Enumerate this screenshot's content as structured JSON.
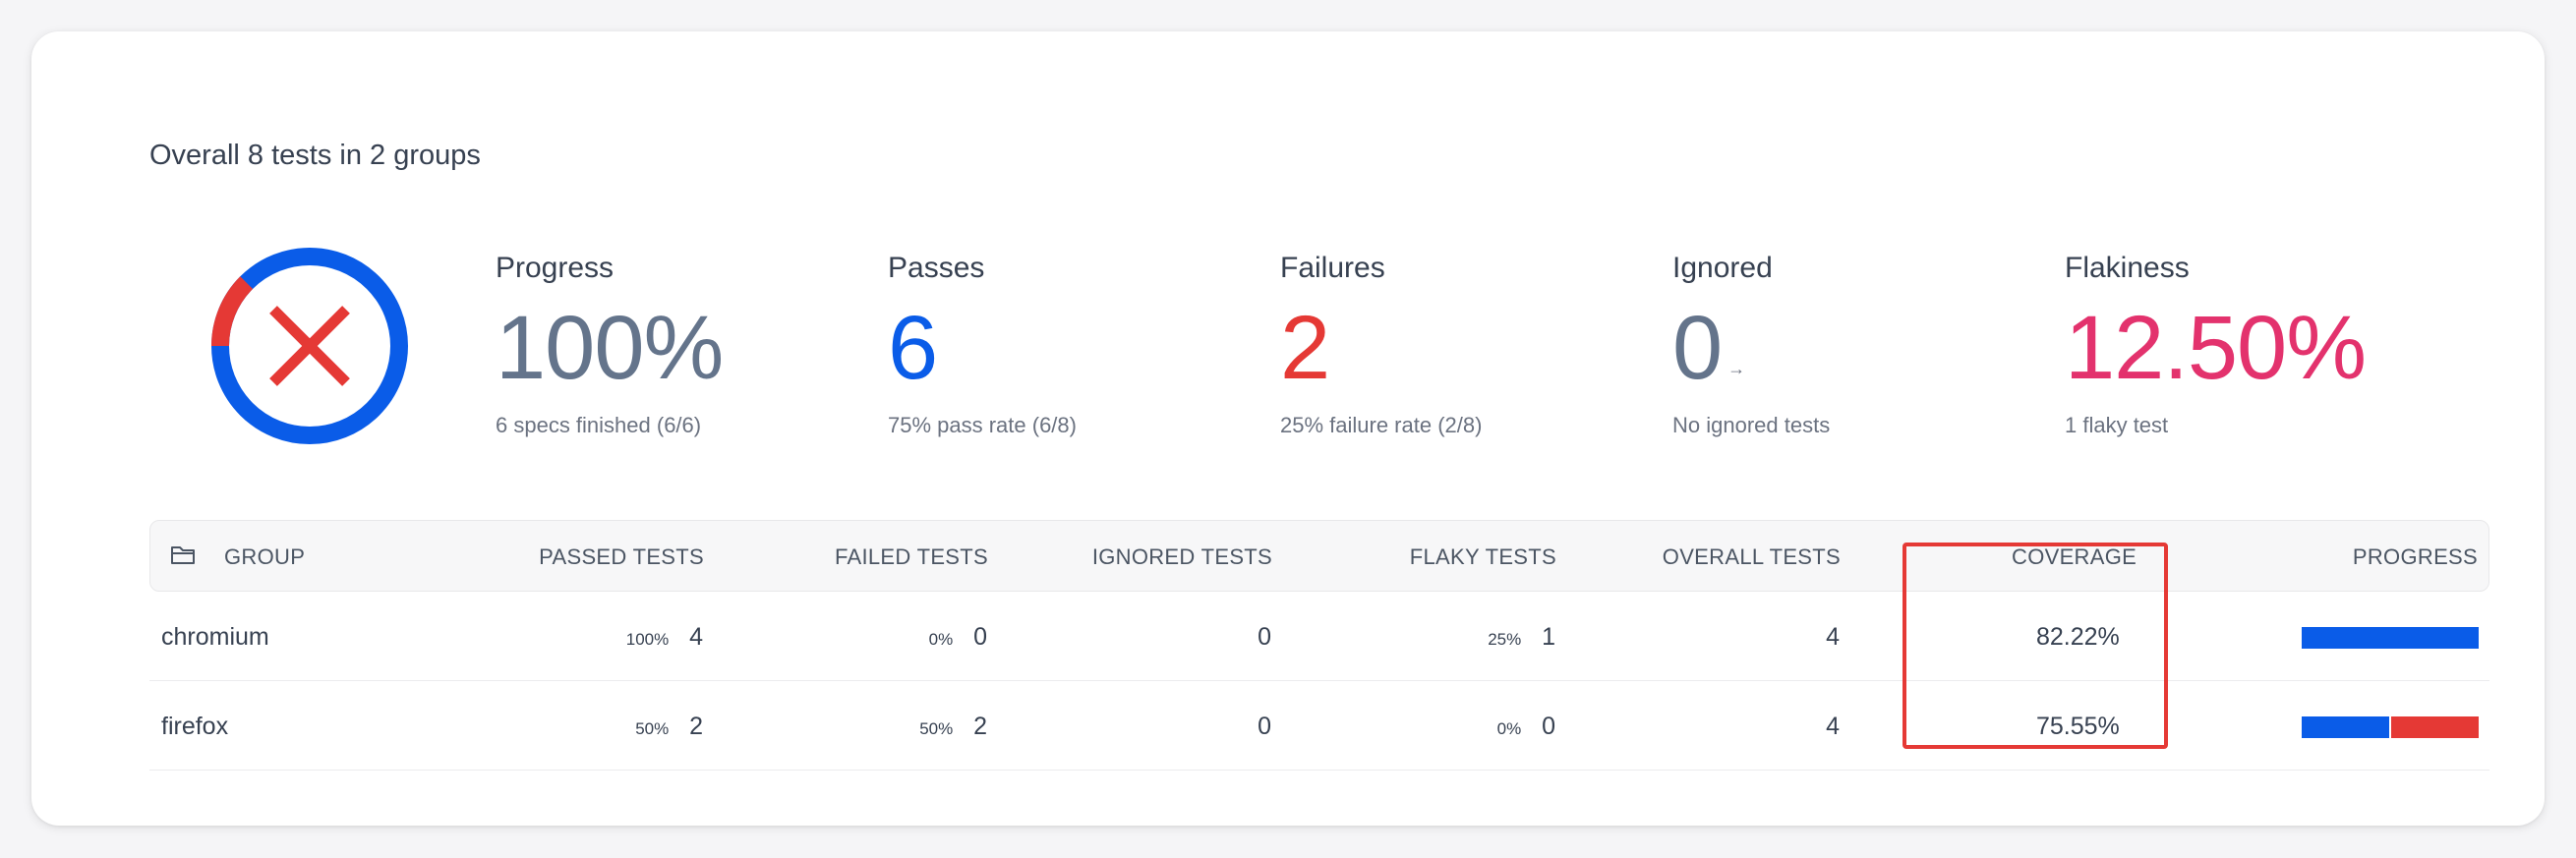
{
  "summary": {
    "headline": "Overall 8 tests in 2 groups",
    "status_icon": "failed-x-icon",
    "donut": {
      "passed_fraction": 0.875,
      "failed_fraction": 0.125,
      "colors": {
        "passed": "#0a5ce8",
        "failed": "#e53935"
      }
    }
  },
  "stats": {
    "progress": {
      "label": "Progress",
      "value": "100%",
      "sub": "6 specs finished (6/6)"
    },
    "passes": {
      "label": "Passes",
      "value": "6",
      "sub": "75% pass rate (6/8)"
    },
    "failures": {
      "label": "Failures",
      "value": "2",
      "sub": "25% failure rate (2/8)"
    },
    "ignored": {
      "label": "Ignored",
      "value": "0",
      "arrow": "→",
      "sub": "No ignored tests"
    },
    "flakiness": {
      "label": "Flakiness",
      "value": "12.50%",
      "sub": "1 flaky test"
    }
  },
  "table": {
    "headers": {
      "group": "GROUP",
      "passed": "PASSED TESTS",
      "failed": "FAILED TESTS",
      "ignored": "IGNORED TESTS",
      "flaky": "FLAKY TESTS",
      "overall": "OVERALL TESTS",
      "coverage": "COVERAGE",
      "progress": "PROGRESS"
    },
    "rows": [
      {
        "group": "chromium",
        "passed_pct": "100%",
        "passed": "4",
        "failed_pct": "0%",
        "failed": "0",
        "ignored": "0",
        "flaky_pct": "25%",
        "flaky": "1",
        "overall": "4",
        "coverage": "82.22%",
        "progress": {
          "passed_fraction": 1.0,
          "failed_fraction": 0.0
        }
      },
      {
        "group": "firefox",
        "passed_pct": "50%",
        "passed": "2",
        "failed_pct": "50%",
        "failed": "2",
        "ignored": "0",
        "flaky_pct": "0%",
        "flaky": "0",
        "overall": "4",
        "coverage": "75.55%",
        "progress": {
          "passed_fraction": 0.5,
          "failed_fraction": 0.5
        }
      }
    ]
  },
  "colors": {
    "accent_blue": "#0a5ce8",
    "error_red": "#e53935",
    "flaky_pink": "#e3326d",
    "neutral": "#64748b"
  }
}
